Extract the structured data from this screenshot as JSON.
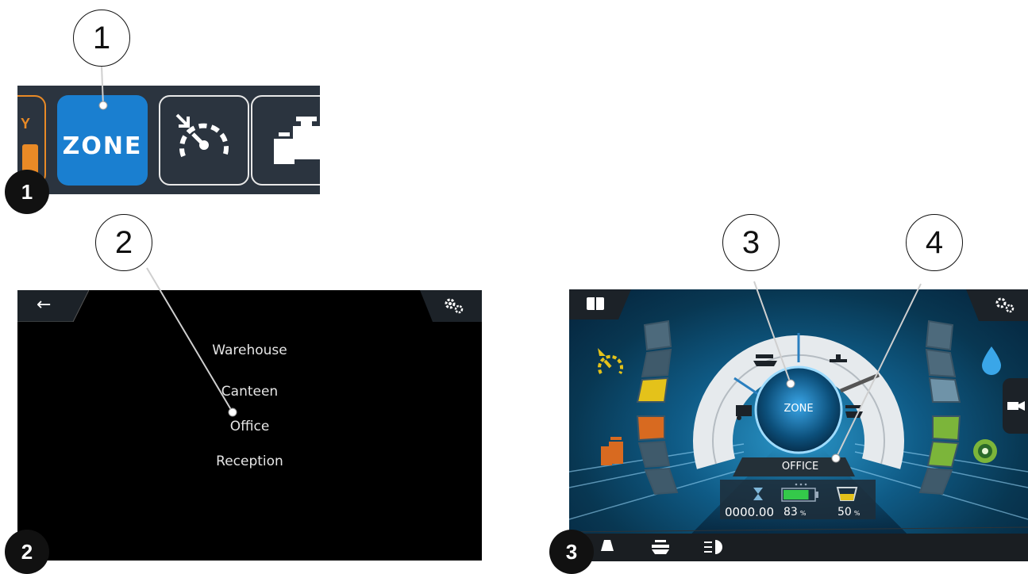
{
  "callouts": {
    "c1": "1",
    "c2": "2",
    "c3": "3",
    "c4": "4"
  },
  "badges": {
    "b1": "1",
    "b2": "2",
    "b3": "3"
  },
  "panel1": {
    "partial_tile_letter": "Y",
    "zone_tile_label": "ZONE",
    "zone_tile_color": "#1a7fd0",
    "icons": [
      "speed-limit-icon",
      "payload-weight-icon"
    ]
  },
  "panel2": {
    "back_icon": "←",
    "settings_icon": "gears-icon",
    "zones": [
      "Warehouse",
      "Canteen",
      "Office",
      "Reception"
    ]
  },
  "panel3": {
    "top_left_icon": "manual-book-icon",
    "top_right_icon": "gears-icon",
    "dial_center_label": "ZONE",
    "current_zone_label": "OFFICE",
    "hour_meter": "0000.00",
    "battery_percent": "83",
    "battery_level": 0.83,
    "solution_percent": "50",
    "percent_unit": "%",
    "bottom_icons": [
      "detergent-icon",
      "scrub-brush-icon",
      "headlight-icon"
    ],
    "accent_yellow": "#e4c21a",
    "accent_orange": "#d86a20",
    "accent_green": "#7cb53a",
    "accent_blue": "#3aa6e8"
  }
}
